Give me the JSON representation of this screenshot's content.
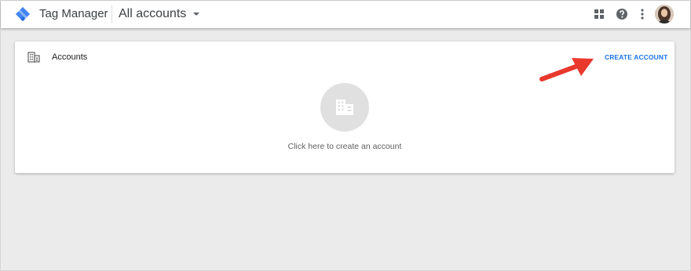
{
  "header": {
    "app_name": "Tag Manager",
    "account_selector": "All accounts",
    "icons": [
      "apps-grid-icon",
      "help-icon",
      "more-vert-icon",
      "user-avatar"
    ]
  },
  "card": {
    "title": "Accounts",
    "create_account_label": "CREATE ACCOUNT",
    "empty_state_text": "Click here to create an account"
  },
  "colors": {
    "accent": "#1a73e8",
    "annotation_arrow": "#e8392c",
    "background": "#ebebeb"
  }
}
